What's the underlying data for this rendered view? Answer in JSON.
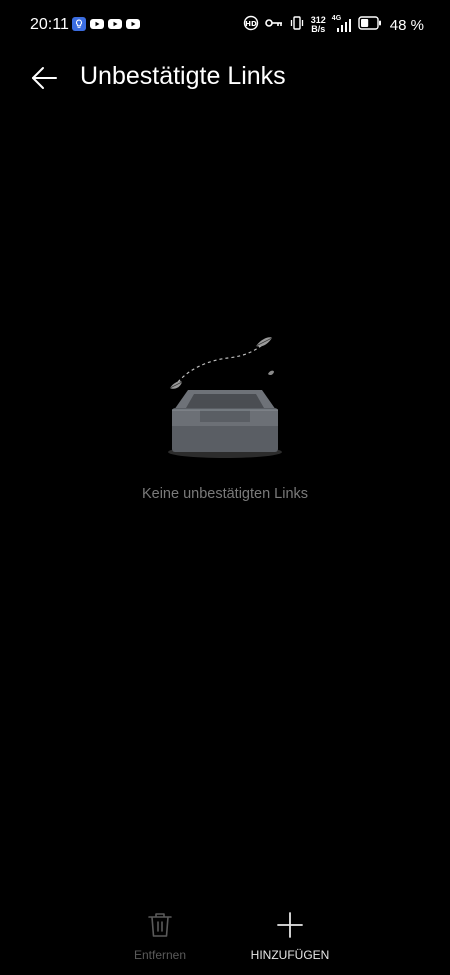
{
  "status_bar": {
    "time": "20:11",
    "net_speed_value": "312",
    "net_speed_unit": "B/s",
    "network_type": "4G",
    "battery_percent": "48 %",
    "battery_level": 0.48
  },
  "header": {
    "title": "Unbestätigte Links"
  },
  "empty_state": {
    "message": "Keine unbestätigten Links"
  },
  "toolbar": {
    "remove_label": "Entfernen",
    "add_label": "HINZUFÜGEN"
  },
  "colors": {
    "background": "#000000",
    "text_primary": "#ffffff",
    "text_muted": "#7a7a7a",
    "disabled": "#5a5a5a"
  }
}
